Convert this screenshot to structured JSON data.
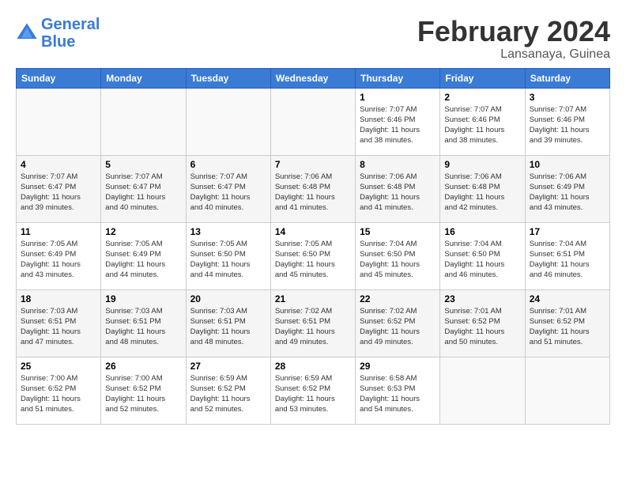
{
  "header": {
    "logo_line1": "General",
    "logo_line2": "Blue",
    "title": "February 2024",
    "subtitle": "Lansanaya, Guinea"
  },
  "days_of_week": [
    "Sunday",
    "Monday",
    "Tuesday",
    "Wednesday",
    "Thursday",
    "Friday",
    "Saturday"
  ],
  "weeks": [
    [
      {
        "day": "",
        "info": ""
      },
      {
        "day": "",
        "info": ""
      },
      {
        "day": "",
        "info": ""
      },
      {
        "day": "",
        "info": ""
      },
      {
        "day": "1",
        "info": "Sunrise: 7:07 AM\nSunset: 6:46 PM\nDaylight: 11 hours\nand 38 minutes."
      },
      {
        "day": "2",
        "info": "Sunrise: 7:07 AM\nSunset: 6:46 PM\nDaylight: 11 hours\nand 38 minutes."
      },
      {
        "day": "3",
        "info": "Sunrise: 7:07 AM\nSunset: 6:46 PM\nDaylight: 11 hours\nand 39 minutes."
      }
    ],
    [
      {
        "day": "4",
        "info": "Sunrise: 7:07 AM\nSunset: 6:47 PM\nDaylight: 11 hours\nand 39 minutes."
      },
      {
        "day": "5",
        "info": "Sunrise: 7:07 AM\nSunset: 6:47 PM\nDaylight: 11 hours\nand 40 minutes."
      },
      {
        "day": "6",
        "info": "Sunrise: 7:07 AM\nSunset: 6:47 PM\nDaylight: 11 hours\nand 40 minutes."
      },
      {
        "day": "7",
        "info": "Sunrise: 7:06 AM\nSunset: 6:48 PM\nDaylight: 11 hours\nand 41 minutes."
      },
      {
        "day": "8",
        "info": "Sunrise: 7:06 AM\nSunset: 6:48 PM\nDaylight: 11 hours\nand 41 minutes."
      },
      {
        "day": "9",
        "info": "Sunrise: 7:06 AM\nSunset: 6:48 PM\nDaylight: 11 hours\nand 42 minutes."
      },
      {
        "day": "10",
        "info": "Sunrise: 7:06 AM\nSunset: 6:49 PM\nDaylight: 11 hours\nand 43 minutes."
      }
    ],
    [
      {
        "day": "11",
        "info": "Sunrise: 7:05 AM\nSunset: 6:49 PM\nDaylight: 11 hours\nand 43 minutes."
      },
      {
        "day": "12",
        "info": "Sunrise: 7:05 AM\nSunset: 6:49 PM\nDaylight: 11 hours\nand 44 minutes."
      },
      {
        "day": "13",
        "info": "Sunrise: 7:05 AM\nSunset: 6:50 PM\nDaylight: 11 hours\nand 44 minutes."
      },
      {
        "day": "14",
        "info": "Sunrise: 7:05 AM\nSunset: 6:50 PM\nDaylight: 11 hours\nand 45 minutes."
      },
      {
        "day": "15",
        "info": "Sunrise: 7:04 AM\nSunset: 6:50 PM\nDaylight: 11 hours\nand 45 minutes."
      },
      {
        "day": "16",
        "info": "Sunrise: 7:04 AM\nSunset: 6:50 PM\nDaylight: 11 hours\nand 46 minutes."
      },
      {
        "day": "17",
        "info": "Sunrise: 7:04 AM\nSunset: 6:51 PM\nDaylight: 11 hours\nand 46 minutes."
      }
    ],
    [
      {
        "day": "18",
        "info": "Sunrise: 7:03 AM\nSunset: 6:51 PM\nDaylight: 11 hours\nand 47 minutes."
      },
      {
        "day": "19",
        "info": "Sunrise: 7:03 AM\nSunset: 6:51 PM\nDaylight: 11 hours\nand 48 minutes."
      },
      {
        "day": "20",
        "info": "Sunrise: 7:03 AM\nSunset: 6:51 PM\nDaylight: 11 hours\nand 48 minutes."
      },
      {
        "day": "21",
        "info": "Sunrise: 7:02 AM\nSunset: 6:51 PM\nDaylight: 11 hours\nand 49 minutes."
      },
      {
        "day": "22",
        "info": "Sunrise: 7:02 AM\nSunset: 6:52 PM\nDaylight: 11 hours\nand 49 minutes."
      },
      {
        "day": "23",
        "info": "Sunrise: 7:01 AM\nSunset: 6:52 PM\nDaylight: 11 hours\nand 50 minutes."
      },
      {
        "day": "24",
        "info": "Sunrise: 7:01 AM\nSunset: 6:52 PM\nDaylight: 11 hours\nand 51 minutes."
      }
    ],
    [
      {
        "day": "25",
        "info": "Sunrise: 7:00 AM\nSunset: 6:52 PM\nDaylight: 11 hours\nand 51 minutes."
      },
      {
        "day": "26",
        "info": "Sunrise: 7:00 AM\nSunset: 6:52 PM\nDaylight: 11 hours\nand 52 minutes."
      },
      {
        "day": "27",
        "info": "Sunrise: 6:59 AM\nSunset: 6:52 PM\nDaylight: 11 hours\nand 52 minutes."
      },
      {
        "day": "28",
        "info": "Sunrise: 6:59 AM\nSunset: 6:52 PM\nDaylight: 11 hours\nand 53 minutes."
      },
      {
        "day": "29",
        "info": "Sunrise: 6:58 AM\nSunset: 6:53 PM\nDaylight: 11 hours\nand 54 minutes."
      },
      {
        "day": "",
        "info": ""
      },
      {
        "day": "",
        "info": ""
      }
    ]
  ]
}
